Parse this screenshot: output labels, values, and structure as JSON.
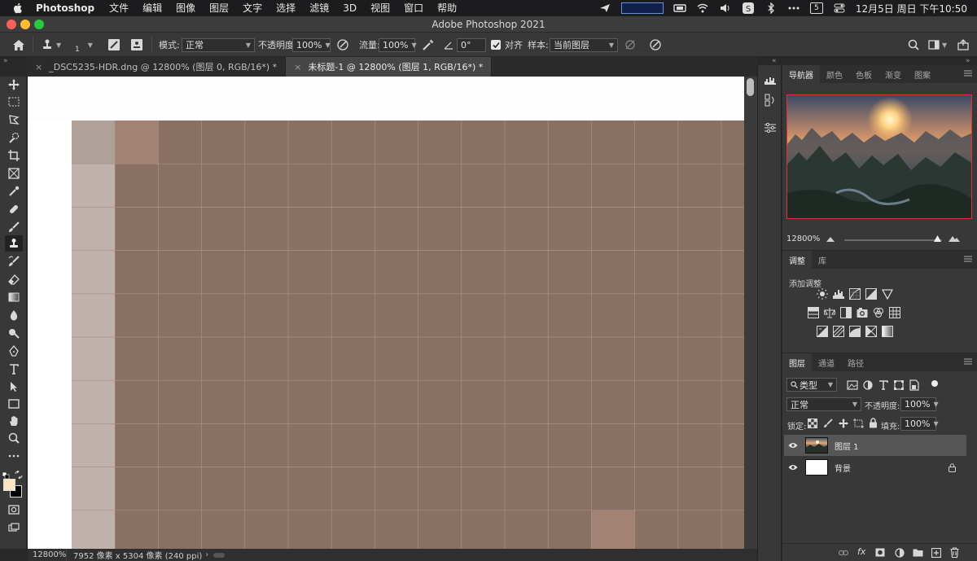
{
  "menubar": {
    "app_name": "Photoshop",
    "menus": [
      "文件",
      "编辑",
      "图像",
      "图层",
      "文字",
      "选择",
      "滤镜",
      "3D",
      "视图",
      "窗口",
      "帮助"
    ],
    "clock": "12月5日 周日 下午10:50",
    "tray_icons": [
      "send-icon",
      "input-method-icon",
      "tray-app-icon",
      "wifi-icon",
      "volume-icon",
      "sogou-icon",
      "bluetooth-icon",
      "more-icon",
      "calendar-icon",
      "control-center-icon"
    ],
    "calendar_badge": "5"
  },
  "window": {
    "title": "Adobe Photoshop 2021"
  },
  "options_bar": {
    "brush_size": "1",
    "mode_label": "模式:",
    "mode_value": "正常",
    "opacity_label": "不透明度:",
    "opacity_value": "100%",
    "flow_label": "流量:",
    "flow_value": "100%",
    "angle_value": "0°",
    "aligned_label": "对齐",
    "aligned_checked": true,
    "sample_label": "样本:",
    "sample_value": "当前图层"
  },
  "tabs": [
    {
      "label": "_DSC5235-HDR.dng @ 12800% (图层 0, RGB/16*) *",
      "active": false
    },
    {
      "label": "未标题-1 @ 12800% (图层 1, RGB/16*) *",
      "active": true
    }
  ],
  "toolbox": {
    "tools": [
      "move-tool",
      "marquee-tool",
      "lasso-tool",
      "quick-select-tool",
      "crop-tool",
      "frame-tool",
      "eyedropper-tool",
      "healing-brush-tool",
      "brush-tool",
      "clone-stamp-tool",
      "history-brush-tool",
      "eraser-tool",
      "gradient-tool",
      "blur-tool",
      "dodge-tool",
      "pen-tool",
      "type-tool",
      "path-select-tool",
      "rectangle-tool",
      "hand-tool",
      "zoom-tool",
      "edit-toolbar"
    ],
    "active_tool": "clone-stamp-tool",
    "foreground_color": "#fde3c1",
    "background_color": "#000000"
  },
  "status": {
    "zoom": "12800%",
    "info": "7952 像素 x 5304 像素 (240 ppi)"
  },
  "navigator": {
    "tabs": [
      "导航器",
      "颜色",
      "色板",
      "渐变",
      "图案"
    ],
    "zoom": "12800%",
    "zoom_level_fraction": 0.95
  },
  "adjustments": {
    "tabs": [
      "调整",
      "库"
    ],
    "title": "添加调整"
  },
  "layers": {
    "tabs": [
      "图层",
      "通道",
      "路径"
    ],
    "filter_label": "类型",
    "blend_mode": "正常",
    "opacity_label": "不透明度:",
    "opacity_value": "100%",
    "lock_label": "锁定:",
    "fill_label": "填充:",
    "fill_value": "100%",
    "items": [
      {
        "name": "图层 1",
        "selected": true,
        "visible": true,
        "locked": false
      },
      {
        "name": "背景",
        "selected": false,
        "visible": true,
        "locked": true
      }
    ]
  },
  "colors": {
    "canvas_pixel": "#8a7062",
    "pixel_light": "#bfb1ab",
    "pixel_corner": "#b0a09a",
    "pixel_highlight": "#a28373",
    "grid_line": "#a8928a"
  }
}
